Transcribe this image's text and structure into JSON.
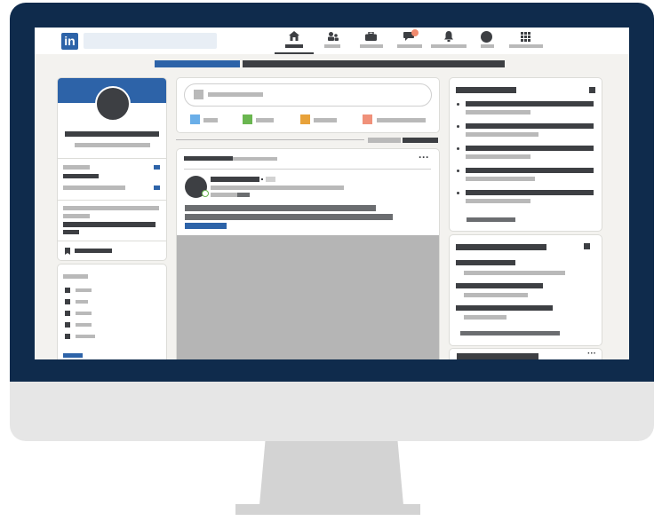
{
  "app": {
    "logo_text": "in"
  },
  "nav": {
    "items": [
      {
        "name": "home",
        "icon": "home-icon",
        "active": true
      },
      {
        "name": "network",
        "icon": "people-icon",
        "active": false
      },
      {
        "name": "jobs",
        "icon": "briefcase-icon",
        "active": false
      },
      {
        "name": "messaging",
        "icon": "chat-icon",
        "active": false,
        "badge": true
      },
      {
        "name": "notifications",
        "icon": "bell-icon",
        "active": false
      },
      {
        "name": "me",
        "icon": "avatar-icon",
        "active": false
      },
      {
        "name": "work",
        "icon": "grid-icon",
        "active": false
      }
    ]
  },
  "feed": {
    "post_menu": "···"
  },
  "news2": {
    "menu": "···"
  },
  "colors": {
    "frame": "#0f2b4c",
    "stand": "#d3d3d3",
    "brand_blue": "#2d63a8",
    "page_bg": "#f3f2ef",
    "placeholder_dark": "#3d3f43",
    "placeholder_light": "#b9b9b9",
    "badge": "#f08a6e",
    "photo_blue": "#6aaee8",
    "video_green": "#6ab650",
    "event_orange": "#e8a23a",
    "article_salmon": "#f0917a",
    "online_green": "#6ab650"
  }
}
